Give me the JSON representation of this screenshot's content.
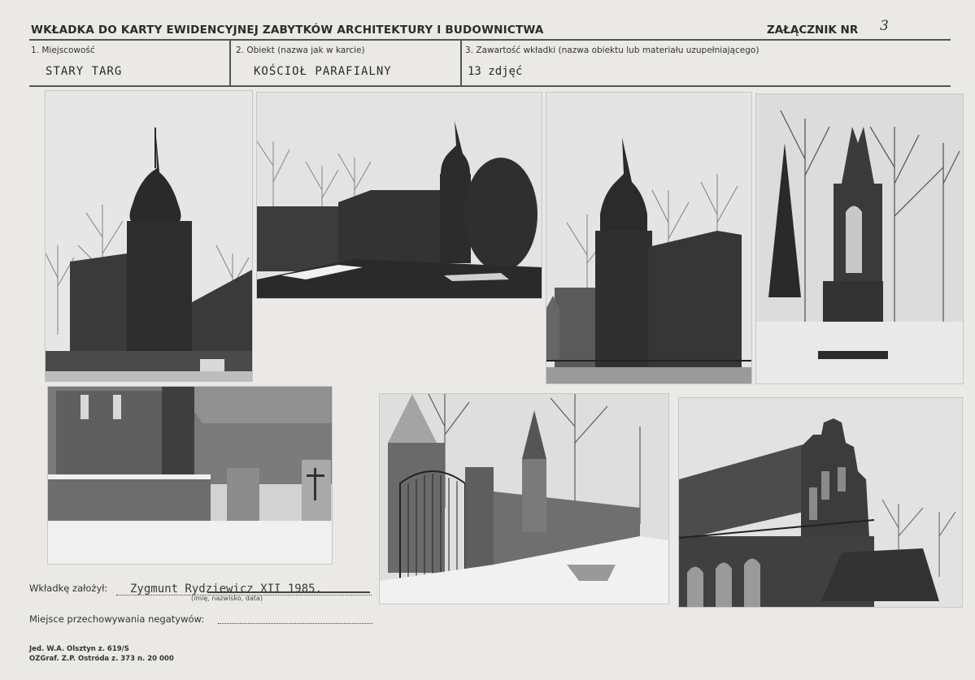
{
  "header": {
    "title": "WKŁADKA DO KARTY EWIDENCYJNEJ ZABYTKÓW ARCHITEKTURY I BUDOWNICTWA",
    "annex_label": "ZAŁĄCZNIK NR",
    "annex_number": "3"
  },
  "fields": [
    {
      "label": "1. Miejscowość",
      "value": "STARY TARG"
    },
    {
      "label": "2. Obiekt (nazwa jak w karcie)",
      "value": "KOŚCIOŁ PARAFIALNY"
    },
    {
      "label": "3. Zawartość wkładki (nazwa obiektu lub materiału uzupełniającego)",
      "value": "13 zdjęć"
    }
  ],
  "footer": {
    "founder_label": "Wkładkę założył:",
    "founder_value": "Zygmunt Rydziewicz XII 1985.",
    "founder_hint": "(imię, nazwisko, data)",
    "storage_label": "Miejsce przechowywania negatywów:",
    "printer_line1": "Jed. W.A. Olsztyn z. 619/S",
    "printer_line2": "OZGraf. Z.P. Ostróda z. 373 n. 20 000"
  }
}
